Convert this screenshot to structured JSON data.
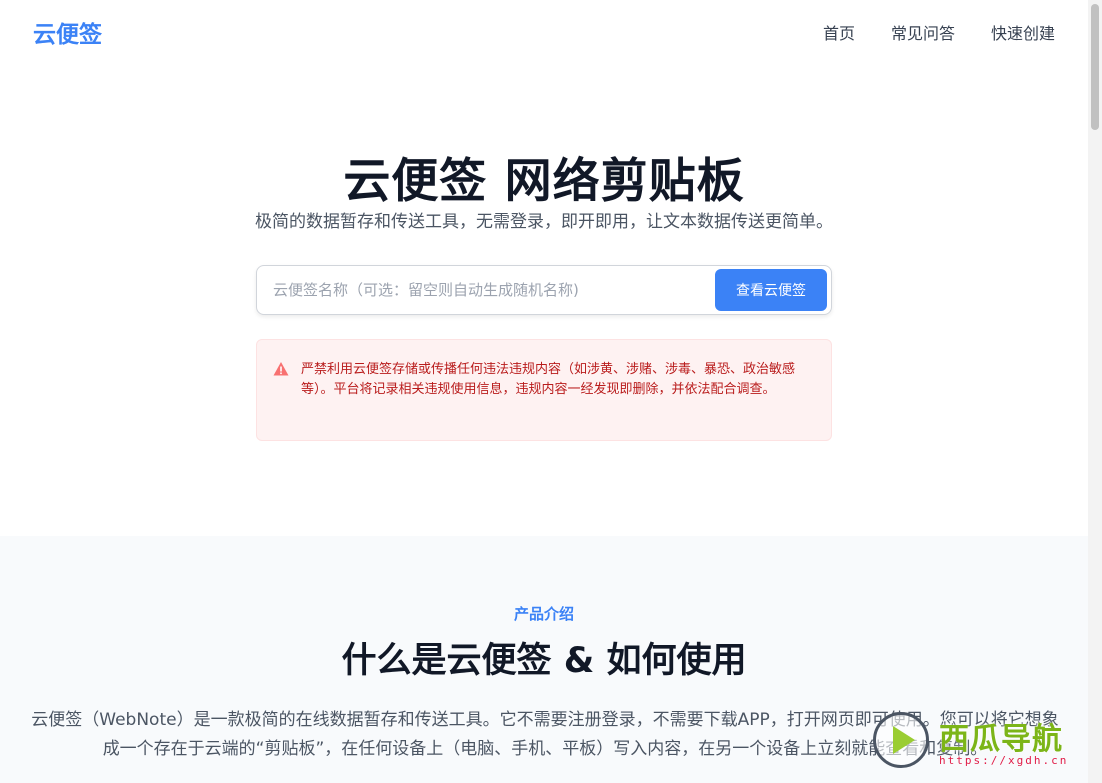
{
  "nav": {
    "logo": "云便签",
    "links": [
      "首页",
      "常见问答",
      "快速创建"
    ]
  },
  "hero": {
    "title": "云便签 网络剪贴板",
    "subtitle": "极简的数据暂存和传送工具，无需登录，即开即用，让文本数据传送更简单。",
    "search_placeholder": "云便签名称（可选：留空则自动生成随机名称)",
    "search_button": "查看云便签"
  },
  "warning": {
    "icon": "warning-triangle-icon",
    "text": "严禁利用云便签存储或传播任何违法违规内容（如涉黄、涉赌、涉毒、暴恐、政治敏感等）。平台将记录相关违规使用信息，违规内容一经发现即删除，并依法配合调查。"
  },
  "intro": {
    "eyebrow": "产品介绍",
    "heading": "什么是云便签 & 如何使用",
    "body": "云便签（WebNote）是一款极简的在线数据暂存和传送工具。它不需要注册登录，不需要下载APP，打开网页即可使用。您可以将它想象成一个存在于云端的“剪贴板”，在任何设备上（电脑、手机、平板）写入内容，在另一个设备上立刻就能查看和复制。"
  },
  "watermark": {
    "title": "西瓜导航",
    "url": "https://xgdh.cn"
  },
  "colors": {
    "accent": "#3b82f6",
    "warning_bg": "#fef2f2",
    "warning_text": "#b91c1c"
  }
}
